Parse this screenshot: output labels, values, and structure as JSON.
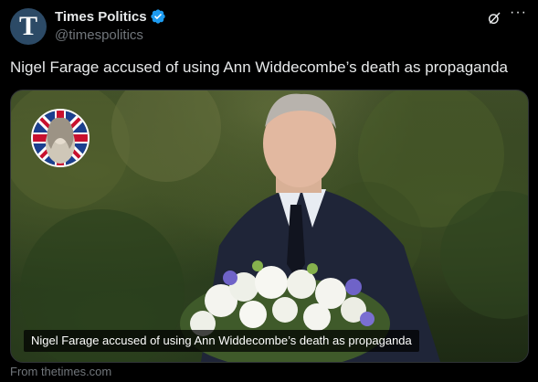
{
  "account": {
    "avatar_letter": "T",
    "display_name": "Times Politics",
    "handle": "@timespolitics",
    "verified_icon": "verified-badge-icon"
  },
  "tweet": {
    "text": "Nigel Farage accused of using Ann Widdecombe’s death as propaganda"
  },
  "media": {
    "caption": "Nigel Farage accused of using Ann Widdecombe’s death as propaganda",
    "source": "From thetimes.com"
  },
  "colors": {
    "background": "#000000",
    "text": "#e7e9ea",
    "muted": "#71767b",
    "verified": "#1d9bf0"
  }
}
